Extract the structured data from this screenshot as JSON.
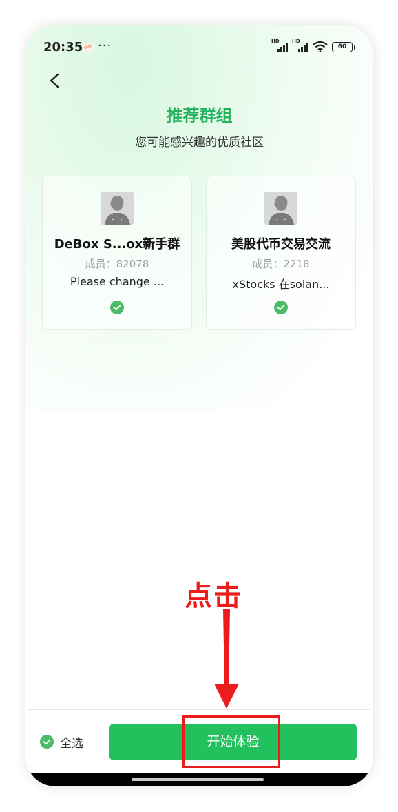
{
  "status_bar": {
    "time": "20:35",
    "app_badge": "小红",
    "dots": "···",
    "signal_label_1": "HD",
    "signal_label_2": "HD",
    "battery": "60"
  },
  "header": {
    "back_icon": "chevron-left-icon",
    "title": "推荐群组",
    "subtitle": "您可能感兴趣的优质社区"
  },
  "groups": [
    {
      "name": "DeBox S...ox新手群",
      "members_label": "成员：82078",
      "description": "Please change ...",
      "selected": true
    },
    {
      "name": "美股代币交易交流",
      "members_label": "成员：2218",
      "description": "xStocks 在solan...",
      "selected": true
    }
  ],
  "annotation": {
    "label": "点击",
    "color": "#ea1c1c"
  },
  "footer": {
    "select_all_label": "全选",
    "start_button_label": "开始体验"
  },
  "colors": {
    "accent": "#22c15e",
    "title": "#24b35c",
    "check": "#4cbc6a"
  }
}
